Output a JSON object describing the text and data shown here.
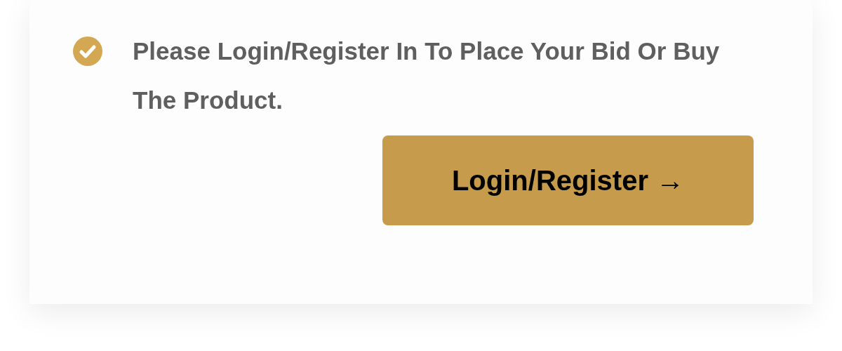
{
  "notice": {
    "checked": true,
    "message": "Please Login/Register In To Place Your Bid Or Buy The Product."
  },
  "button": {
    "label": "Login/Register →"
  }
}
